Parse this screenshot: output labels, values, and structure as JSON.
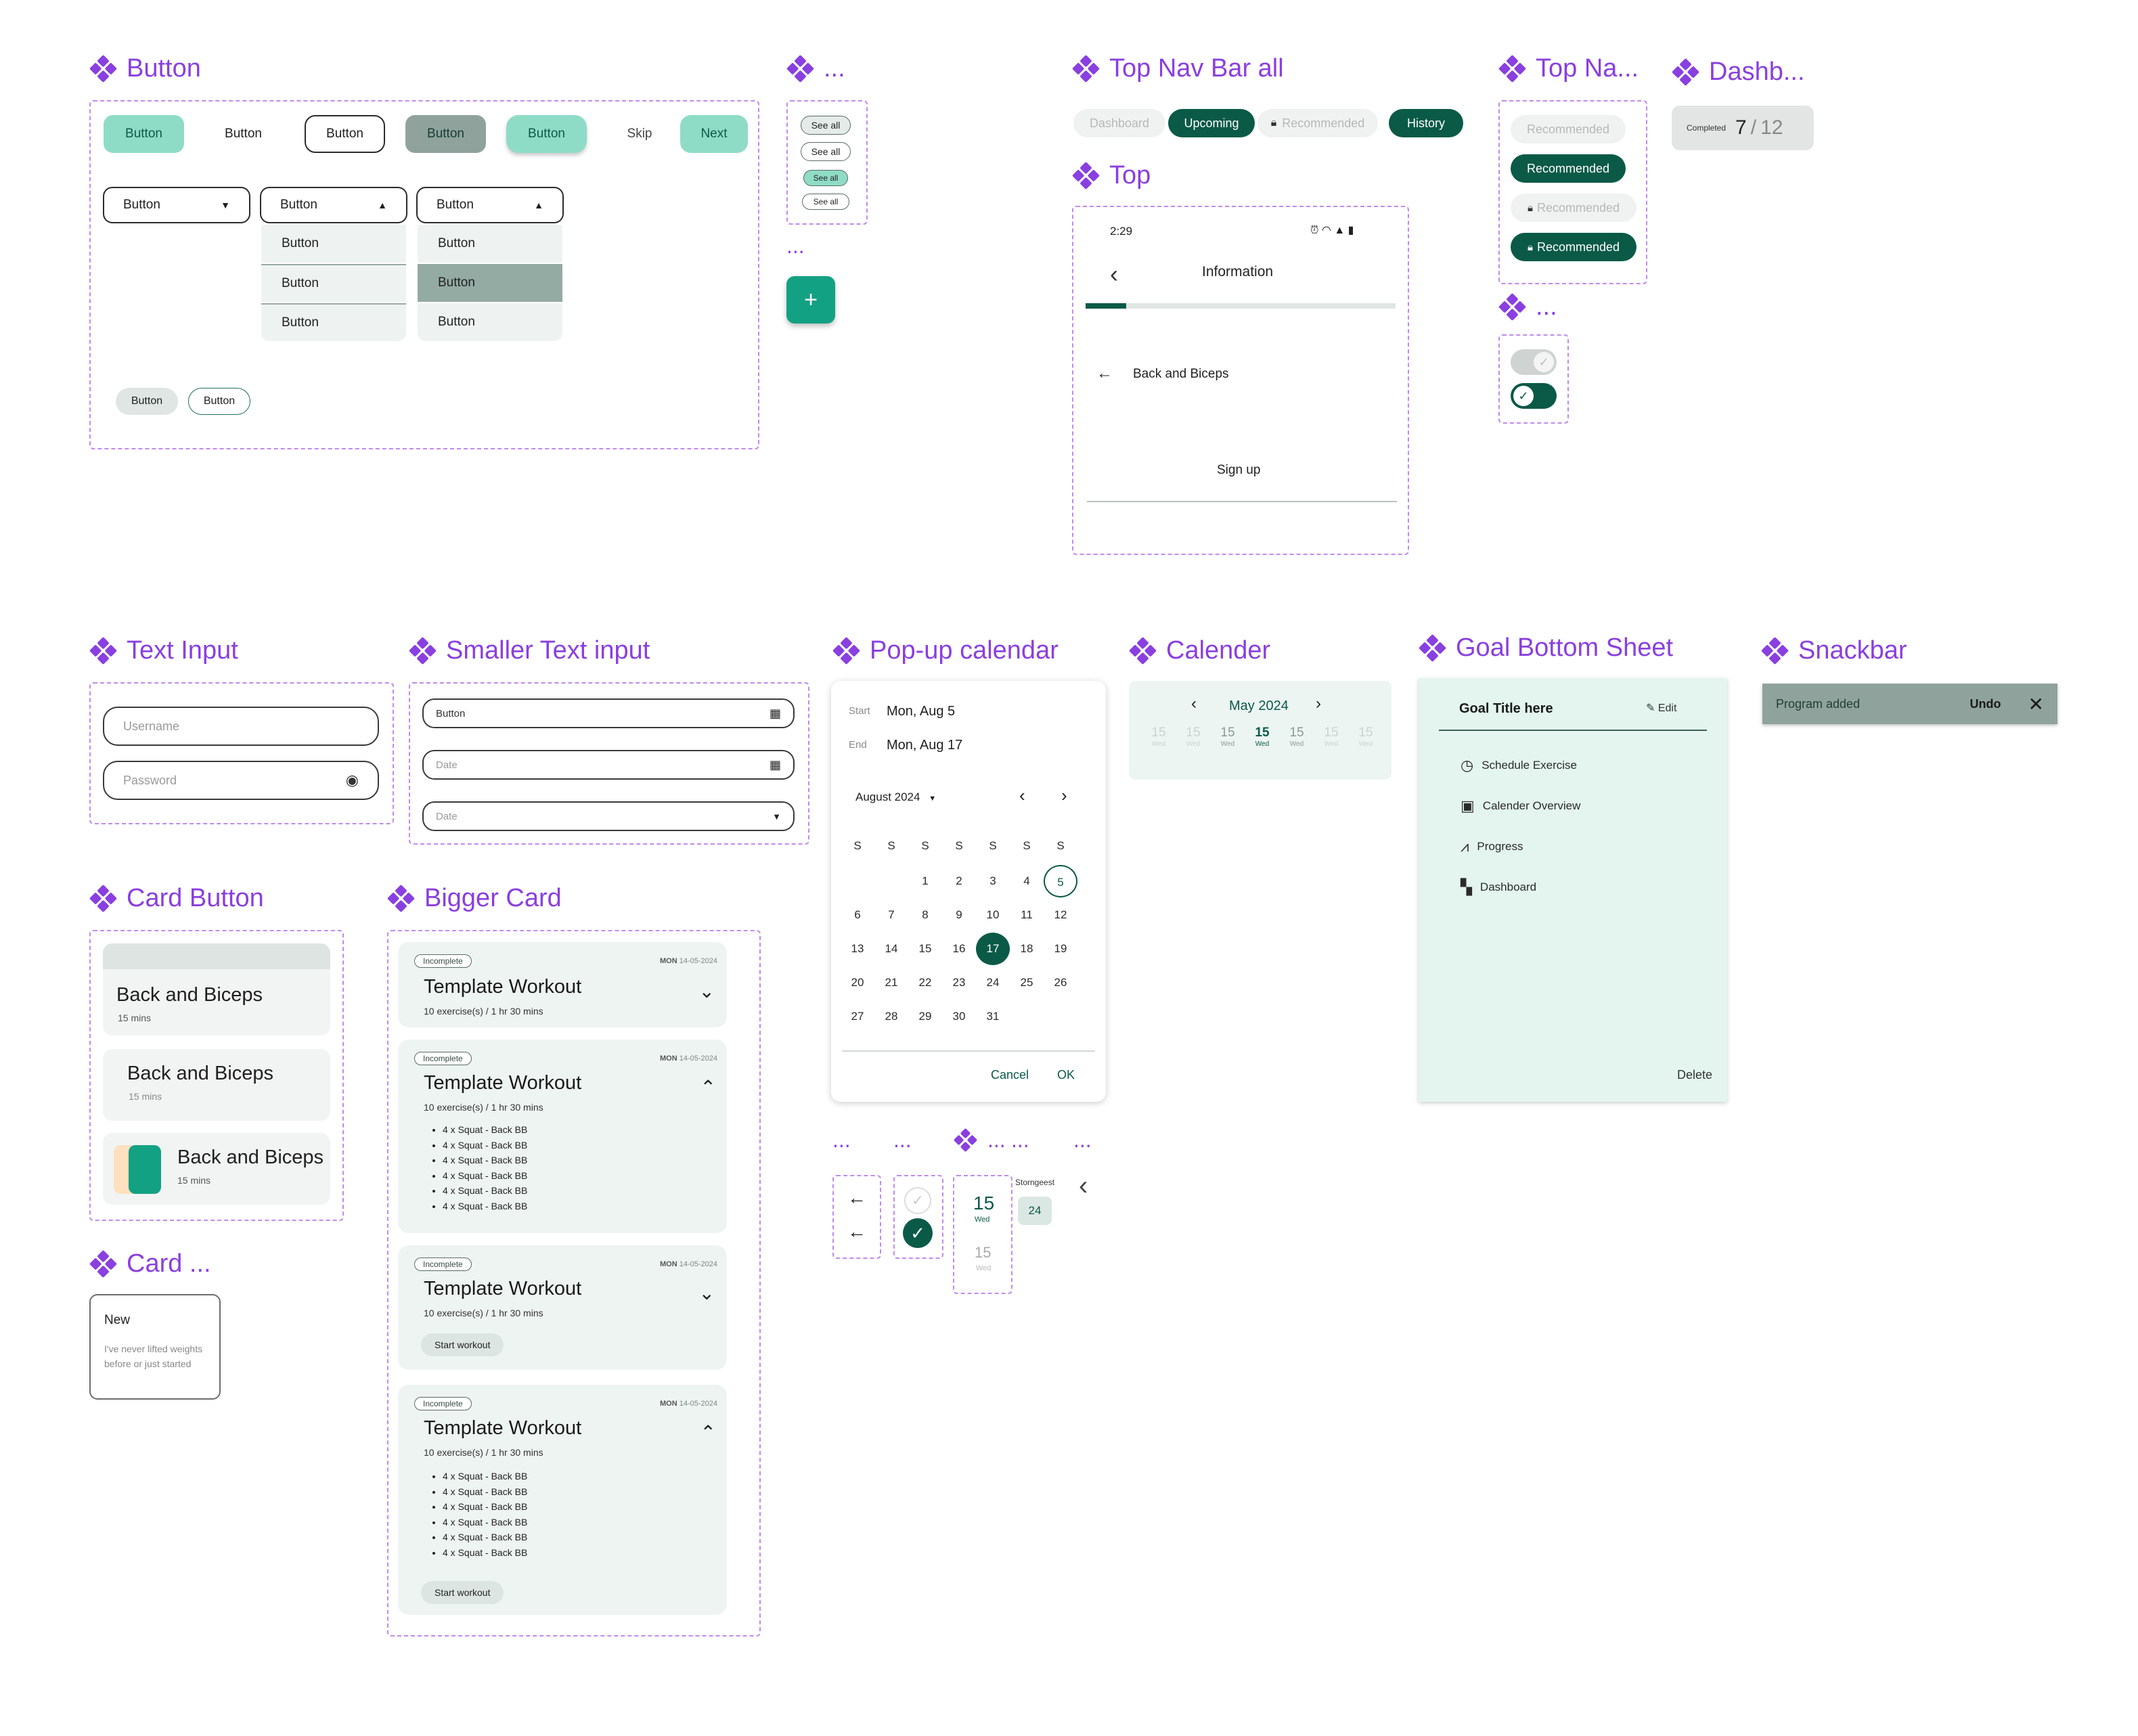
{
  "sections": {
    "button": "Button",
    "see_all_group": "...",
    "top_nav_bar_all": "Top Nav Bar all",
    "top_nav_small": "Top Na...",
    "dashboard": "Dashb...",
    "top": "Top",
    "toggle_group": "...",
    "text_input": "Text Input",
    "smaller_text_input": "Smaller Text input",
    "popup_calendar": "Pop-up calendar",
    "calendar": "Calender",
    "goal_bottom_sheet": "Goal Bottom Sheet",
    "snackbar": "Snackbar",
    "card_button": "Card Button",
    "bigger_card": "Bigger Card",
    "card_small": "Card ...",
    "fab_group": "...",
    "misc_dots": [
      "...",
      "...",
      "...",
      "...",
      "..."
    ]
  },
  "buttons": {
    "row": [
      "Button",
      "Button",
      "Button",
      "Button",
      "Button",
      "Skip",
      "Next"
    ],
    "dropdowns": [
      "Button",
      "Button",
      "Button"
    ],
    "dropdown_options": [
      "Button",
      "Button",
      "Button"
    ],
    "small": [
      "Button",
      "Button"
    ]
  },
  "see_all": [
    "See all",
    "See all",
    "See all",
    "See all"
  ],
  "fab": "+",
  "top_nav": {
    "tabs": [
      "Dashboard",
      "Upcoming",
      "Recommended",
      "History"
    ],
    "small_tabs": [
      "Recommended",
      "Recommended",
      "Recommended",
      "Recommended"
    ]
  },
  "dashboard_badge": {
    "label": "Completed",
    "value": "7",
    "sep": "/",
    "total": "12"
  },
  "top_screen": {
    "time": "2:29",
    "title": "Information",
    "progress": 0.13,
    "back_label": "Back and Biceps",
    "sign_up": "Sign up"
  },
  "text_input": {
    "username": "Username",
    "password": "Password"
  },
  "smaller_input": {
    "field1": "Button",
    "field2": "Date",
    "field3": "Date"
  },
  "card_button": [
    {
      "title": "Back and Biceps",
      "sub": "15 mins"
    },
    {
      "title": "Back and Biceps",
      "sub": "15 mins"
    },
    {
      "title": "Back and Biceps",
      "sub": "15 mins"
    }
  ],
  "card_new": {
    "title": "New",
    "desc": "I've never lifted weights before or just started"
  },
  "bigger_cards": {
    "badge": "Incomplete",
    "day": "MON",
    "date": "14-05-2024",
    "title": "Template Workout",
    "sub": "10 exercise(s) / 1 hr 30 mins",
    "item": "4 x Squat - Back BB",
    "start": "Start workout"
  },
  "popup_calendar": {
    "start_label": "Start",
    "start_value": "Mon, Aug 5",
    "end_label": "End",
    "end_value": "Mon, Aug 17",
    "month": "August 2024",
    "weekdays": [
      "S",
      "S",
      "S",
      "S",
      "S",
      "S",
      "S"
    ],
    "weeks": [
      [
        "",
        "",
        "1",
        "2",
        "3",
        "4",
        "5"
      ],
      [
        "6",
        "7",
        "8",
        "9",
        "10",
        "11",
        "12"
      ],
      [
        "13",
        "14",
        "15",
        "16",
        "17",
        "18",
        "19"
      ],
      [
        "20",
        "21",
        "22",
        "23",
        "24",
        "25",
        "26"
      ],
      [
        "27",
        "28",
        "29",
        "30",
        "31",
        "",
        ""
      ]
    ],
    "cancel": "Cancel",
    "ok": "OK"
  },
  "calendar_strip": {
    "month": "May 2024",
    "days": [
      {
        "n": "15",
        "d": "Wed"
      },
      {
        "n": "15",
        "d": "Wed"
      },
      {
        "n": "15",
        "d": "Wed"
      },
      {
        "n": "15",
        "d": "Wed"
      },
      {
        "n": "15",
        "d": "Wed"
      },
      {
        "n": "15",
        "d": "Wed"
      },
      {
        "n": "15",
        "d": "Wed"
      }
    ]
  },
  "goal_sheet": {
    "title": "Goal Title here",
    "edit": "Edit",
    "items": [
      "Schedule Exercise",
      "Calender Overview",
      "Progress",
      "Dashboard"
    ],
    "delete": "Delete"
  },
  "snackbar": {
    "text": "Program added",
    "action": "Undo"
  },
  "misc": {
    "day_num": "15",
    "day_name": "Wed",
    "day_num2": "15",
    "day_name2": "Wed",
    "strongest": "Storngeest",
    "strongest_val": "24"
  },
  "colors": {
    "accent": "#8a3fe0",
    "primary": "#0a5a47",
    "mint": "#8fdcc6",
    "sheet": "#e3f5ee"
  }
}
